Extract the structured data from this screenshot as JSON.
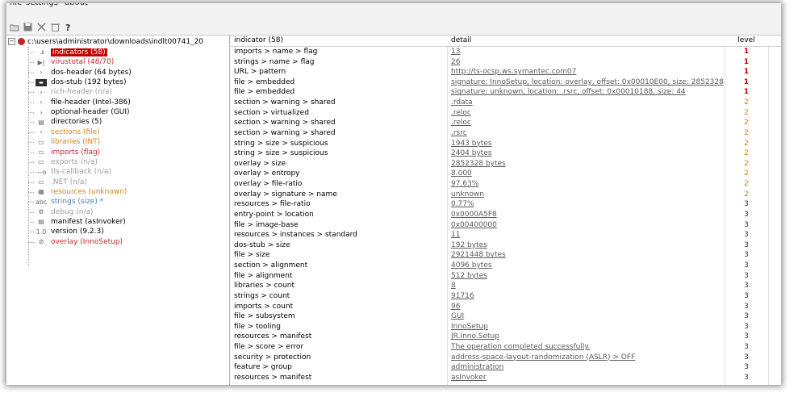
{
  "menu": {
    "items": [
      "file",
      "settings",
      "about"
    ]
  },
  "toolbar": {
    "icons": [
      "open-folder-icon",
      "save-icon",
      "close-file-icon",
      "delete-icon",
      "help-icon"
    ]
  },
  "tree": {
    "root_label": "c:\\users\\administrator\\downloads\\indlt00741_20",
    "items": [
      {
        "label": "indicators (58)",
        "icon": "indicators-icon",
        "color": "selected"
      },
      {
        "label": "virustotal (48/70)",
        "icon": "virustotal-icon",
        "color": "red"
      },
      {
        "label": "dos-header (64 bytes)",
        "icon": "chevron-right-icon",
        "color": "black"
      },
      {
        "label": "dos-stub (192 bytes)",
        "icon": "dos-stub-icon",
        "color": "black"
      },
      {
        "label": "rich-header (n/a)",
        "icon": "chevron-right-icon",
        "color": "grey"
      },
      {
        "label": "file-header (Intel-386)",
        "icon": "chevron-right-icon",
        "color": "black"
      },
      {
        "label": "optional-header (GUI)",
        "icon": "chevron-right-icon",
        "color": "black"
      },
      {
        "label": "directories (5)",
        "icon": "directories-icon",
        "color": "black"
      },
      {
        "label": "sections (file)",
        "icon": "chevron-right-icon",
        "color": "orange"
      },
      {
        "label": "libraries (INT)",
        "icon": "libraries-icon",
        "color": "orange"
      },
      {
        "label": "imports (flag)",
        "icon": "imports-icon",
        "color": "red"
      },
      {
        "label": "exports (n/a)",
        "icon": "exports-icon",
        "color": "grey"
      },
      {
        "label": "tls-callback (n/a)",
        "icon": "tls-callback-icon",
        "color": "grey"
      },
      {
        "label": ".NET (n/a)",
        "icon": "dotnet-icon",
        "color": "grey"
      },
      {
        "label": "resources (unknown)",
        "icon": "resources-icon",
        "color": "orange"
      },
      {
        "label": "strings (size) *",
        "icon": "strings-icon",
        "color": "blue"
      },
      {
        "label": "debug (n/a)",
        "icon": "debug-icon",
        "color": "grey"
      },
      {
        "label": "manifest (asInvoker)",
        "icon": "manifest-icon",
        "color": "black"
      },
      {
        "label": "version (9.2.3)",
        "icon": "version-icon",
        "color": "black"
      },
      {
        "label": "overlay (InnoSetup)",
        "icon": "overlay-icon",
        "color": "red"
      }
    ]
  },
  "grid": {
    "headers": {
      "indicator": "indicator (58)",
      "detail": "detail",
      "level": "level"
    },
    "rows": [
      {
        "indicator": "imports > name > flag",
        "detail": "13",
        "level": "1"
      },
      {
        "indicator": "strings > name > flag",
        "detail": "26",
        "level": "1"
      },
      {
        "indicator": "URL > pattern",
        "detail": "http://ts-ocsp.ws.symantec.com07",
        "level": "1"
      },
      {
        "indicator": "file > embedded",
        "detail": "signature: InnoSetup, location: overlay, offset: 0x00010E00, size: 2852328",
        "level": "1"
      },
      {
        "indicator": "file > embedded",
        "detail": "signature: unknown, location: .rsrc, offset: 0x00010188, size: 44",
        "level": "1"
      },
      {
        "indicator": "section > warning > shared",
        "detail": ".rdata",
        "level": "2"
      },
      {
        "indicator": "section > virtualized",
        "detail": ".reloc",
        "level": "2"
      },
      {
        "indicator": "section > warning > shared",
        "detail": ".reloc",
        "level": "2"
      },
      {
        "indicator": "section > warning > shared",
        "detail": ".rsrc",
        "level": "2"
      },
      {
        "indicator": "string > size > suspicious",
        "detail": "1943 bytes",
        "level": "2"
      },
      {
        "indicator": "string > size > suspicious",
        "detail": "2404 bytes",
        "level": "2"
      },
      {
        "indicator": "overlay > size",
        "detail": "2852328 bytes",
        "level": "2"
      },
      {
        "indicator": "overlay > entropy",
        "detail": "8.000",
        "level": "2"
      },
      {
        "indicator": "overlay > file-ratio",
        "detail": "97.63%",
        "level": "2"
      },
      {
        "indicator": "overlay > signature > name",
        "detail": "unknown",
        "level": "2"
      },
      {
        "indicator": "resources > file-ratio",
        "detail": "0.77%",
        "level": "3"
      },
      {
        "indicator": "entry-point > location",
        "detail": "0x0000A5F8",
        "level": "3"
      },
      {
        "indicator": "file > image-base",
        "detail": "0x00400000",
        "level": "3"
      },
      {
        "indicator": "resources > instances > standard",
        "detail": "11",
        "level": "3"
      },
      {
        "indicator": "dos-stub > size",
        "detail": "192 bytes",
        "level": "3"
      },
      {
        "indicator": "file > size",
        "detail": "2921448 bytes",
        "level": "3"
      },
      {
        "indicator": "section > alignment",
        "detail": "4096 bytes",
        "level": "3"
      },
      {
        "indicator": "file > alignment",
        "detail": "512 bytes",
        "level": "3"
      },
      {
        "indicator": "libraries > count",
        "detail": "8",
        "level": "3"
      },
      {
        "indicator": "strings > count",
        "detail": "91716",
        "level": "3"
      },
      {
        "indicator": "imports > count",
        "detail": "96",
        "level": "3"
      },
      {
        "indicator": "file > subsystem",
        "detail": "GUI",
        "level": "3"
      },
      {
        "indicator": "file > tooling",
        "detail": "InnoSetup",
        "level": "3"
      },
      {
        "indicator": "resources > manifest",
        "detail": "JR.Inno.Setup",
        "level": "3"
      },
      {
        "indicator": "file > score > error",
        "detail": "The operation completed successfully.",
        "level": "3"
      },
      {
        "indicator": "security > protection",
        "detail": "address-space-layout-randomization (ASLR) > OFF",
        "level": "3"
      },
      {
        "indicator": "feature > group",
        "detail": "administration",
        "level": "3"
      },
      {
        "indicator": "resources > manifest",
        "detail": "asInvoker",
        "level": "3"
      }
    ]
  },
  "colors": {
    "selected": "#c00000",
    "red": "#c0282a",
    "orange": "#d4831b",
    "grey": "#9b9b9b",
    "blue": "#4a7fc1"
  }
}
